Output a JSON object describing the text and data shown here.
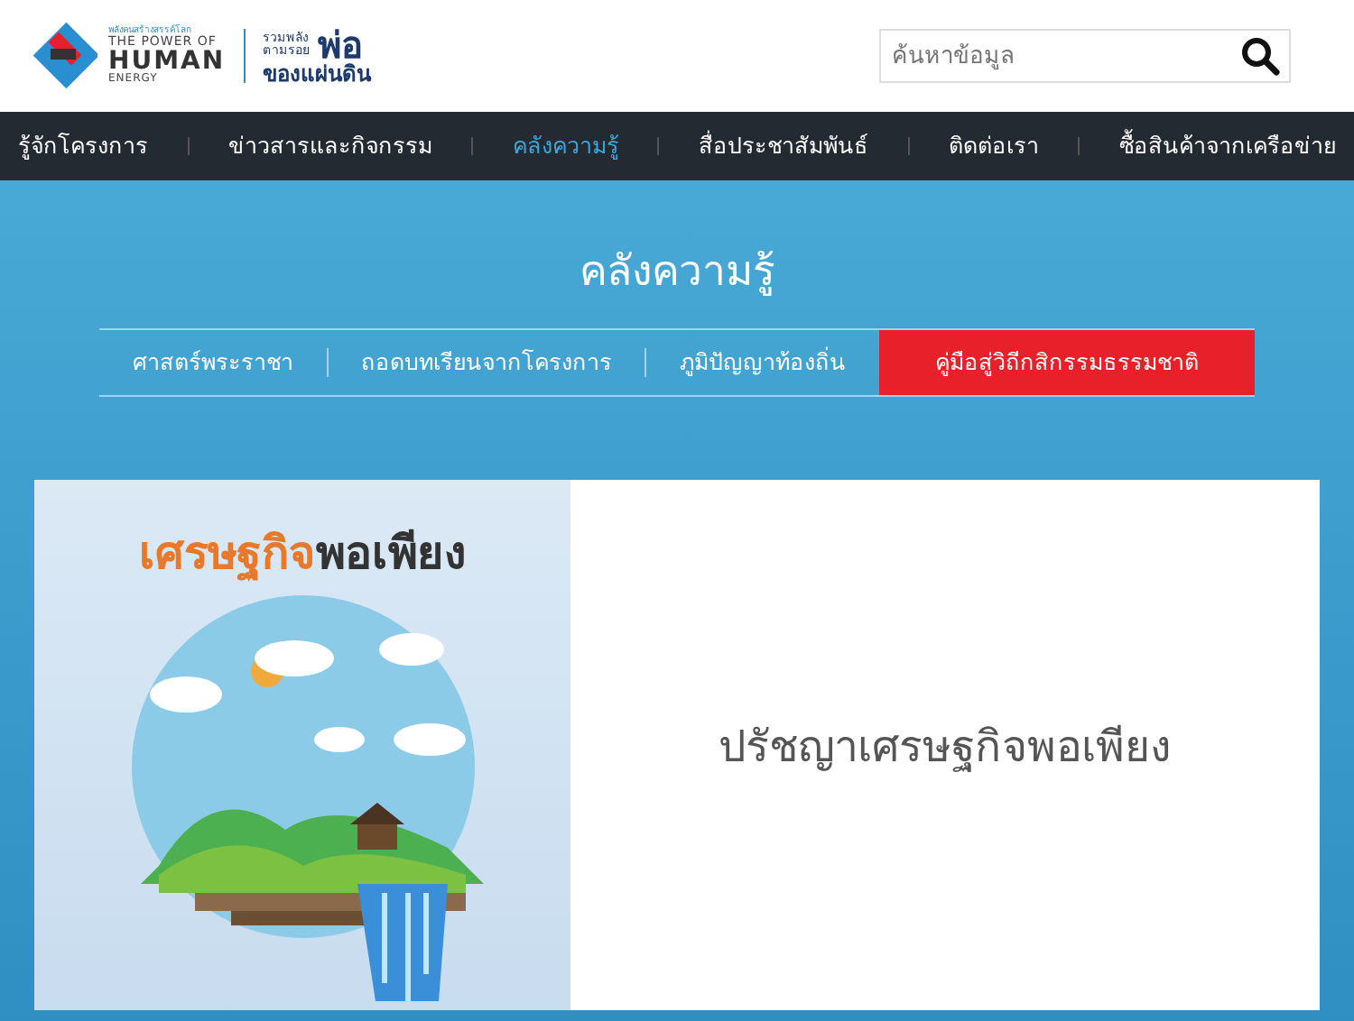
{
  "header": {
    "logo": {
      "tagline": "พลังคนสร้างสรรค์โลก",
      "line_1": "THE POWER OF",
      "line_2": "HUMAN",
      "line_3": "ENERGY",
      "slogan_1": "รวมพลัง",
      "slogan_2": "ตามรอย",
      "slogan_big": "พ่อ",
      "slogan_3": "ของแผ่นดิน"
    },
    "search": {
      "placeholder": "ค้นหาข้อมูล"
    }
  },
  "nav": [
    {
      "label": "รู้จักโครงการ",
      "selected": false
    },
    {
      "label": "ข่าวสารและกิจกรรม",
      "selected": false
    },
    {
      "label": "คลังความรู้",
      "selected": true
    },
    {
      "label": "สื่อประชาสัมพันธ์",
      "selected": false
    },
    {
      "label": "ติดต่อเรา",
      "selected": false
    },
    {
      "label": "ซื้อสินค้าจากเครือข่าย",
      "selected": false
    }
  ],
  "page_title": "คลังความรู้",
  "subtabs": [
    {
      "label": "ศาสตร์พระราชา",
      "selected": false
    },
    {
      "label": "ถอดบทเรียนจากโครงการ",
      "selected": false
    },
    {
      "label": "ภูมิปัญญาท้องถิ่น",
      "selected": false
    },
    {
      "label": "คู่มือสู่วิถีกสิกรรมธรรมชาติ",
      "selected": true
    }
  ],
  "card": {
    "image_heading": {
      "part_1": "เศรษฐกิจ",
      "part_2": "พอเพียง"
    },
    "title": "ปรัชญาเศรษฐกิจพอเพียง"
  }
}
